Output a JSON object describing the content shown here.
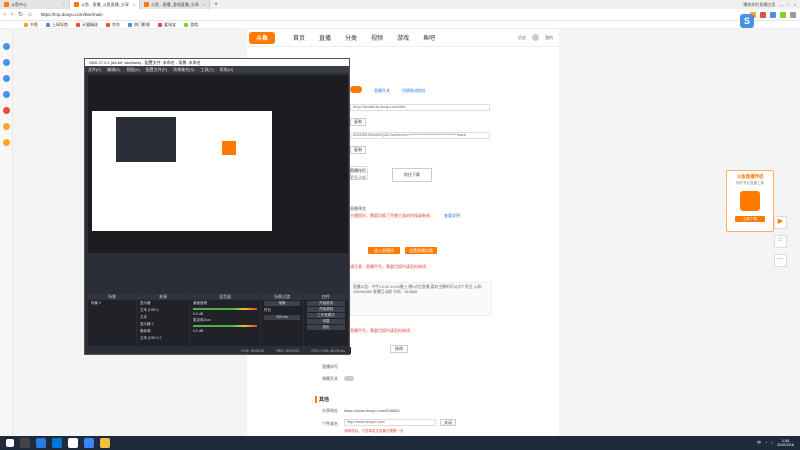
{
  "browser": {
    "tabs": [
      {
        "label": "斗鱼中心",
        "active": false,
        "fav_color": "#ff7a00"
      },
      {
        "label": "斗鱼 - 直播_斗鱼直播_分享",
        "active": true,
        "fav_color": "#ff7a00"
      },
      {
        "label": "斗鱼 - 直播_游戏直播_分享",
        "active": false,
        "fav_color": "#ff7a00"
      }
    ],
    "new_tab": "+",
    "window_right": "播放你的直播应用",
    "url": "https://mp.douyu.com/live/main",
    "bookmarks": [
      "书签",
      "上网导航",
      "天猫精选",
      "京东",
      "热门影视",
      "爱淘宝",
      "游戏"
    ]
  },
  "site": {
    "logo": "斗鱼",
    "nav": [
      {
        "label": "首页",
        "on": false
      },
      {
        "label": "直播",
        "on": false
      },
      {
        "label": "分类",
        "on": false
      },
      {
        "label": "视频",
        "on": false
      },
      {
        "label": "游戏",
        "on": false
      },
      {
        "label": "鱼吧",
        "on": false
      }
    ],
    "nav_right": [
      "历史",
      "我的"
    ]
  },
  "obs": {
    "title": "OBS 27.0.1 (64-bit, windows) - 配置文件: 未命名 - 场景: 未命名",
    "menu": [
      "文件(F)",
      "编辑(E)",
      "视图(V)",
      "配置文件(P)",
      "场景集合(S)",
      "工具(T)",
      "帮助(H)"
    ],
    "docks": {
      "scenes": {
        "header": "场景",
        "items": [
          "场景 2"
        ]
      },
      "sources": {
        "header": "来源",
        "items": [
          "显示器",
          "文本 (GDI+)",
          "文本",
          "显示器 2",
          "媒体源",
          "文本 (GDI+) 2"
        ]
      },
      "mixer": {
        "header": "混音器",
        "items": [
          "桌面音频",
          "麦克风/Aux"
        ],
        "levels": [
          "0.0 dB",
          "0.0 dB"
        ]
      },
      "transitions": {
        "header": "场景过渡",
        "fade": "渐隐",
        "duration_label": "时长",
        "duration": "300 ms"
      },
      "controls": {
        "header": "控件",
        "buttons": [
          "开始推流",
          "开始录制",
          "工作室模式",
          "设置",
          "退出"
        ]
      }
    },
    "status": [
      "LIVE: 00:00:00",
      "REC: 00:00:00",
      "CPU: 0.4%, 60.00 fps"
    ]
  },
  "live_panel": {
    "toggle_label1": "直播开关",
    "toggle_label2": "切换推流地址",
    "rtmp_url": "rtmp://sendtc3a.douyu.com/live",
    "copy1": "复制",
    "stream_key": "8249391IKBsdXEyZs?wsSecret=*********************************&aut",
    "copy2": "复制",
    "qr_label": "直播伴侣",
    "qr_sub": "更多功能",
    "download_btn": "前往下载",
    "tip1": "主播您好，需要切换了开播工具的时候请参阅...",
    "tip1_link": "查看说明",
    "section_obs": "直播预览",
    "btn_orange1": "进入直播间",
    "btn_orange2": "设置直播封面",
    "notice_red": "请注意：直播平台，需要切换时请及时修改...",
    "long_text": "直播公告：中午12:00-14:00晚上 晚9点后直播 喜欢主播的可以点个关注 入群：435980885 直播互动群 号码：516858",
    "edit_btn": "修改",
    "notice_red2": "直播平台，需要切换时请及时修改...",
    "room_label": "直播间号",
    "room_input": "",
    "room_btn": "修改",
    "danmu_label": "弹幕开关",
    "toggle3": "开启",
    "section_other": "其他",
    "share_label": "分享地址",
    "share_url": "https://www.douyu.com/528583",
    "other_label": "个性域名",
    "other_url": "http://www.douyu.com/",
    "other_btn": "关闭",
    "other_tip": "请修改后，个性域名生效最长需要一天"
  },
  "ad": {
    "title": "斗鱼直播伴侣",
    "sub": "你的专业直播工具",
    "btn": "立即下载"
  },
  "float_buttons": [
    "播放",
    "主页",
    "更多"
  ],
  "taskbar": {
    "time": "1:34",
    "date": "2022/2/16",
    "lang": "中"
  },
  "colors": {
    "accent": "#ff7a00",
    "obs_bg": "#2b2e38",
    "taskbar": "#1f2a3d",
    "link": "#2b7be4",
    "warn": "#e64340"
  }
}
